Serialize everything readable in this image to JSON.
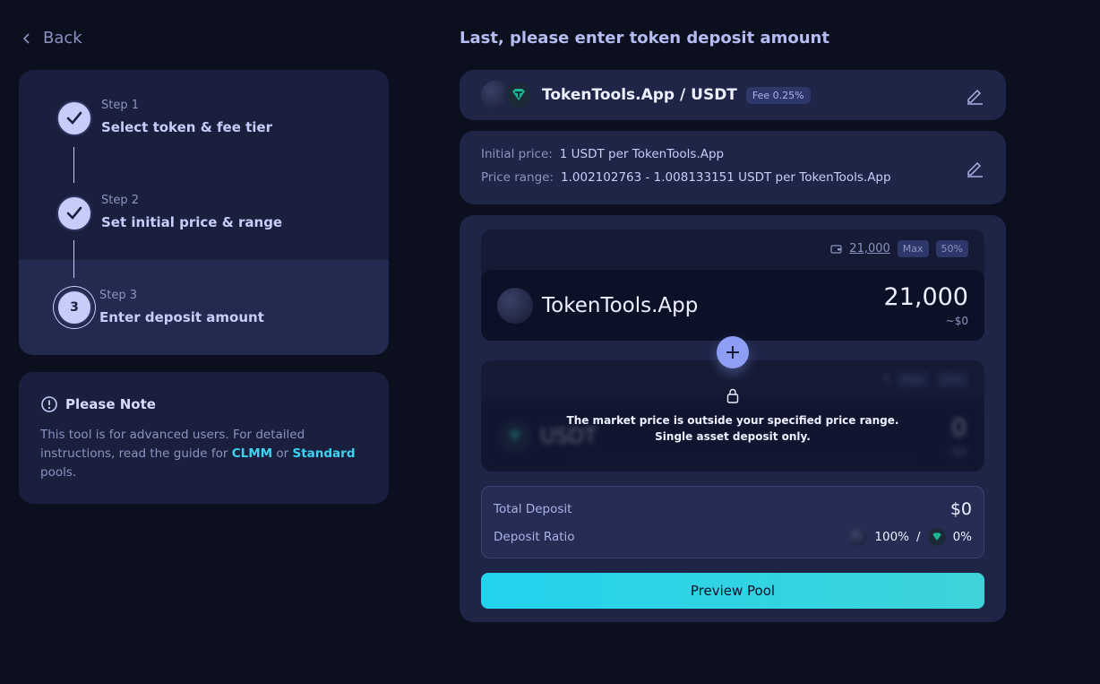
{
  "back_label": "Back",
  "steps": [
    {
      "kicker": "Step 1",
      "title": "Select token & fee tier",
      "done": true
    },
    {
      "kicker": "Step 2",
      "title": "Set initial price & range",
      "done": true
    },
    {
      "kicker": "Step 3",
      "title": "Enter deposit amount",
      "number": "3"
    }
  ],
  "note": {
    "title": "Please Note",
    "text_1": "This tool is for advanced users. For detailed instructions, read the guide for",
    "link_clmm": "CLMM",
    "or": "or",
    "link_standard": "Standard",
    "text_2": "pools."
  },
  "heading": "Last, please enter token deposit amount",
  "pair": {
    "name": "TokenTools.App / USDT",
    "fee": "Fee 0.25%"
  },
  "price": {
    "initial_label": "Initial price:",
    "initial_value": "1  USDT per TokenTools.App",
    "range_label": "Price range:",
    "range_value": "1.002102763 - 1.008133151  USDT per TokenTools.App"
  },
  "input_a": {
    "balance": "21,000",
    "max": "Max",
    "half": "50%",
    "symbol": "TokenTools.App",
    "amount": "21,000",
    "usd": "~$0"
  },
  "input_b": {
    "balance": "0",
    "max": "Max",
    "half": "50%",
    "symbol": "USDT",
    "amount": "0",
    "usd": "~$0"
  },
  "lock_message": "The market price is outside your specified price range. Single asset deposit only.",
  "summary": {
    "total_label": "Total Deposit",
    "total_value": "$0",
    "ratio_label": "Deposit Ratio",
    "ratio_a": "100%",
    "ratio_sep": "/",
    "ratio_b": "0%"
  },
  "preview_label": "Preview Pool",
  "colors": {
    "accent": "#22d3ee",
    "step_circle": "#c6cdfb",
    "card": "#1f2547",
    "background": "#0b0f1e"
  }
}
